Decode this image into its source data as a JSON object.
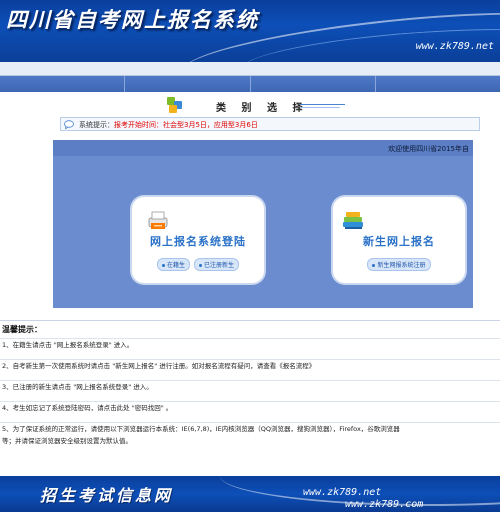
{
  "header": {
    "title": "四川省自考网上报名系统",
    "site": "www.zk789.net"
  },
  "category": {
    "label": "类 别 选 择"
  },
  "notice": {
    "prefix": "系统提示：",
    "highlight": "报考开始时间：社会型3月5日，应用型3月6日"
  },
  "panel": {
    "welcome": "欢迎使用四川省2015年自"
  },
  "cards": {
    "login": {
      "title": "网上报名系统登陆",
      "link1": "在籍生",
      "link2": "已注册新生"
    },
    "register": {
      "title": "新生网上报名",
      "link1": "新生网报系统注册"
    }
  },
  "tips": {
    "heading": "温馨提示：",
    "items": [
      "1、在籍生请点击 \"网上报名系统登录\" 进入。",
      "2、自考新生第一次使用系统时请点击 \"新生网上报名\" 进行注册。如对报名流程有疑问，请查看《报名流程》",
      "3、已注册的新生请点击 \"网上报名系统登录\" 进入。",
      "4、考生如忘记了系统登陆密码，请点击此处 \"密码找回\" 。",
      "5、为了保证系统的正常运行，请使用以下浏览器运行本系统：IE(6,7,8)，IE内核浏览器（QQ浏览器，搜狗浏览器），Firefox，谷歌浏览器",
      "等；并请保证浏览器安全级别设置为默认值。"
    ]
  },
  "footer": {
    "title": "招生考试信息网",
    "site1": "www.zk789.net",
    "site2": "www.zk789.com"
  },
  "colors": {
    "banner": "#0d4fb8",
    "panel": "#6b8ccf",
    "accent_red": "#e00000",
    "link_blue": "#2a72c8"
  }
}
